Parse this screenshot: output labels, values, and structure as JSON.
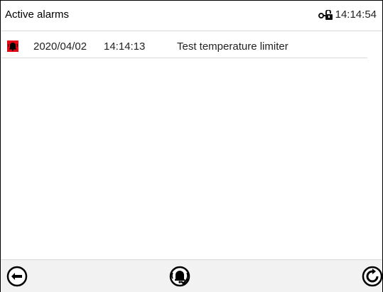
{
  "header": {
    "title": "Active alarms",
    "clock": "14:14:54",
    "lock_icon": "lock-open-icon"
  },
  "alarms": [
    {
      "icon": "alarm-bell-icon",
      "icon_color": "#e30613",
      "date": "2020/04/02",
      "time": "14:14:13",
      "text": "Test temperature limiter"
    }
  ],
  "footer": {
    "back_icon": "back-arrow-icon",
    "acknowledge_icon": "alarm-acknowledge-icon",
    "refresh_icon": "refresh-icon"
  }
}
